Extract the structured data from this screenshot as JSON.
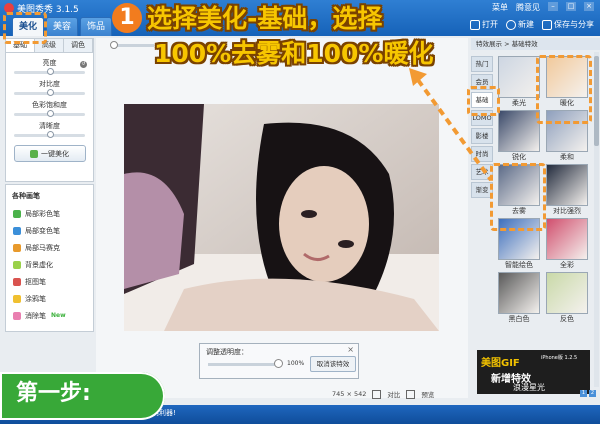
{
  "app": {
    "title": "美图秀秀 3.1.5"
  },
  "main_tabs": [
    {
      "label": "美化"
    },
    {
      "label": "美容"
    },
    {
      "label": "饰品"
    }
  ],
  "top_menu": {
    "menu": "菜单",
    "user": "腾意见"
  },
  "toolbar": {
    "open": "打开",
    "new": "新建",
    "save_share": "保存与分享"
  },
  "sub_tabs": [
    {
      "label": "基础"
    },
    {
      "label": "高级"
    },
    {
      "label": "调色"
    }
  ],
  "adjustments": [
    {
      "label": "亮度",
      "level": 0.5
    },
    {
      "label": "对比度",
      "level": 0.5
    },
    {
      "label": "色彩饱和度",
      "level": 0.5
    },
    {
      "label": "清晰度",
      "level": 0.5
    }
  ],
  "one_key_button": "一键美化",
  "brushes": {
    "title": "各种画笔",
    "items": [
      {
        "label": "局部彩色笔",
        "color": "#4bb24b"
      },
      {
        "label": "局部变色笔",
        "color": "#3b8fd9"
      },
      {
        "label": "局部马赛克",
        "color": "#e89a2c"
      },
      {
        "label": "背景虚化",
        "color": "#9ad14a"
      },
      {
        "label": "抠图笔",
        "color": "#d9534f"
      },
      {
        "label": "涂鸦笔",
        "color": "#f0c030"
      },
      {
        "label": "消除笔",
        "color": "#e97fb0"
      }
    ],
    "new_badge": "New"
  },
  "opacity_panel": {
    "title": "调整透明度：",
    "value": "100%",
    "cancel": "取消该特效",
    "close": "×",
    "level": 1.0
  },
  "status": {
    "dimensions": "745 × 542",
    "compare": "对比",
    "preview": "预览"
  },
  "effects_header": "特效展示 > 基础特效",
  "effect_tabs": [
    {
      "label": "热门"
    },
    {
      "label": "会员"
    },
    {
      "label": "基础"
    },
    {
      "label": "LOMO"
    },
    {
      "label": "影楼"
    },
    {
      "label": "时尚"
    },
    {
      "label": "艺术"
    },
    {
      "label": "渐变"
    }
  ],
  "effects": [
    {
      "label": "柔光",
      "color": "#cdd6e2"
    },
    {
      "label": "暖化",
      "color": "#f2c99b"
    },
    {
      "label": "锐化",
      "color": "#3b4a6a"
    },
    {
      "label": "柔和",
      "color": "#8fa0bd"
    },
    {
      "label": "去雾",
      "color": "#5c6b88"
    },
    {
      "label": "对比强烈",
      "color": "#222b3d"
    },
    {
      "label": "智能绘色",
      "color": "#3d6fbd"
    },
    {
      "label": "全彩",
      "color": "#d14f6e"
    },
    {
      "label": "黑白色",
      "color": "#5a5a5a"
    },
    {
      "label": "反色",
      "color": "#c9d9a8"
    }
  ],
  "ad": {
    "logo": "美图GIF",
    "sub": "iPhone版 1.2.5",
    "line1": "新增特效",
    "line2": "浪漫星光"
  },
  "status_bar_text": "卖萌利器!",
  "step_label": "第一步:",
  "instruction": {
    "number": "1",
    "line1": "选择美化-基础，选择",
    "line2": "100%去雾和100%暖化"
  }
}
